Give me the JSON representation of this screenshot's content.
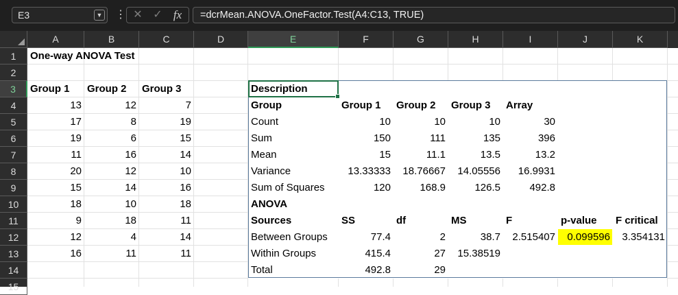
{
  "formula_bar": {
    "name_box": "E3",
    "formula": "=dcrMean.ANOVA.OneFactor.Test(A4:C13, TRUE)",
    "icons": [
      "chevron-down-icon",
      "more-options-icon",
      "cancel-x-icon",
      "enter-check-icon",
      "insert-function-icon"
    ]
  },
  "columns": [
    "A",
    "B",
    "C",
    "D",
    "E",
    "F",
    "G",
    "H",
    "I",
    "J",
    "K"
  ],
  "rows": [
    "1",
    "2",
    "3",
    "4",
    "5",
    "6",
    "7",
    "8",
    "9",
    "10",
    "11",
    "12",
    "13",
    "14",
    "15"
  ],
  "selected": {
    "col": "E",
    "row": "3"
  },
  "colors": {
    "selection": "#1e7145",
    "highlight": "#ffff00",
    "header_bg": "#2d2d2d",
    "table_border": "#5b7a9c"
  },
  "input_data": {
    "title": "One-way ANOVA Test",
    "headers": [
      "Group 1",
      "Group 2",
      "Group 3"
    ],
    "rows": [
      [
        "13",
        "12",
        "7"
      ],
      [
        "17",
        "8",
        "19"
      ],
      [
        "19",
        "6",
        "15"
      ],
      [
        "11",
        "16",
        "14"
      ],
      [
        "20",
        "12",
        "10"
      ],
      [
        "15",
        "14",
        "16"
      ],
      [
        "18",
        "10",
        "18"
      ],
      [
        "9",
        "18",
        "11"
      ],
      [
        "12",
        "4",
        "14"
      ],
      [
        "16",
        "11",
        "11"
      ]
    ]
  },
  "output_table": {
    "description_label": "Description",
    "desc_headers": [
      "Group",
      "Group 1",
      "Group 2",
      "Group 3",
      "Array"
    ],
    "desc_rows": [
      [
        "Count",
        "10",
        "10",
        "10",
        "30"
      ],
      [
        "Sum",
        "150",
        "111",
        "135",
        "396"
      ],
      [
        "Mean",
        "15",
        "11.1",
        "13.5",
        "13.2"
      ],
      [
        "Variance",
        "13.33333",
        "18.76667",
        "14.05556",
        "16.9931"
      ],
      [
        "Sum of Squares",
        "120",
        "168.9",
        "126.5",
        "492.8"
      ]
    ],
    "anova_label": "ANOVA",
    "anova_headers": [
      "Sources",
      "SS",
      "df",
      "MS",
      "F",
      "p-value",
      "F critical"
    ],
    "anova_rows": [
      [
        "Between Groups",
        "77.4",
        "2",
        "38.7",
        "2.515407",
        "0.099596",
        "3.354131"
      ],
      [
        "Within Groups",
        "415.4",
        "27",
        "15.38519",
        "",
        "",
        ""
      ],
      [
        "Total",
        "492.8",
        "29",
        "",
        "",
        "",
        ""
      ]
    ]
  }
}
